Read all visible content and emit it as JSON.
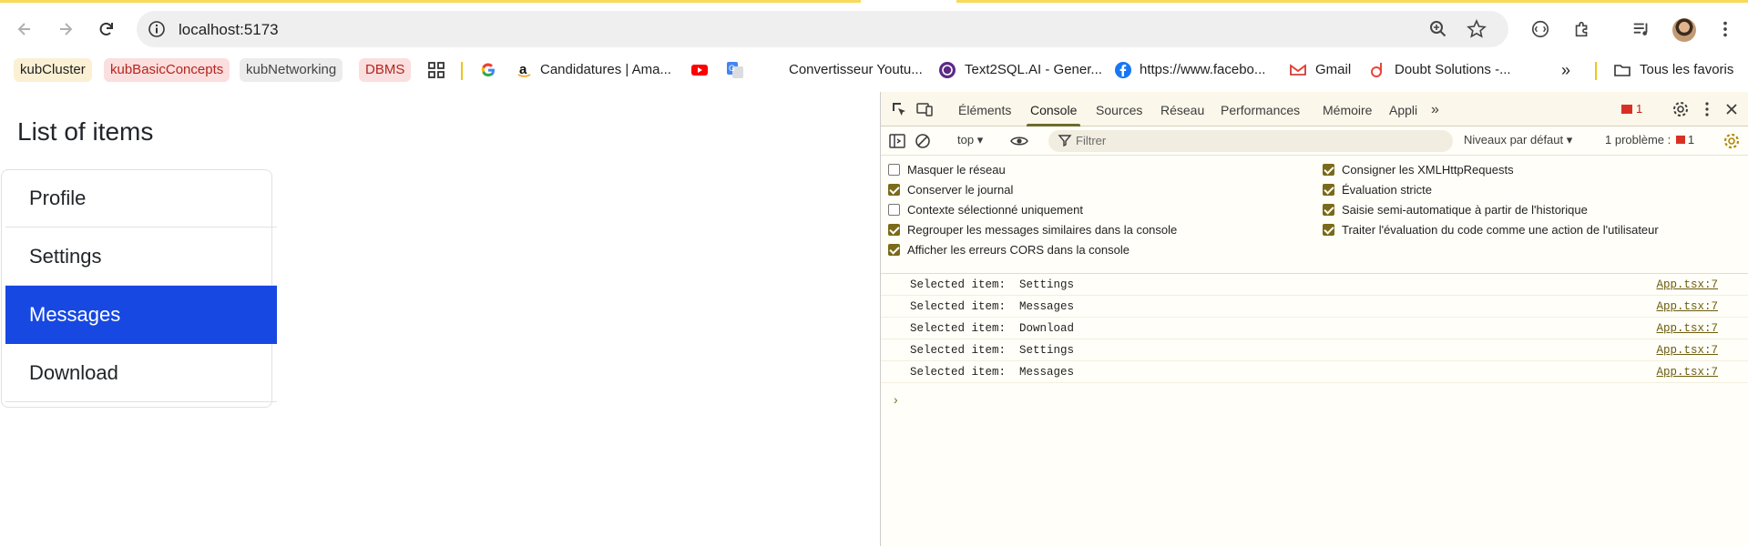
{
  "browser": {
    "url": "localhost:5173",
    "bookmarks": [
      {
        "label": "kubCluster"
      },
      {
        "label": "kubBasicConcepts"
      },
      {
        "label": "kubNetworking"
      },
      {
        "label": "DBMS"
      },
      {
        "label": "Candidatures | Ama..."
      },
      {
        "label": "Convertisseur Youtu..."
      },
      {
        "label": "Text2SQL.AI - Gener..."
      },
      {
        "label": "https://www.facebo..."
      },
      {
        "label": "Gmail"
      },
      {
        "label": "Doubt Solutions -..."
      },
      {
        "label": "Tous les favoris"
      }
    ],
    "more_bookmarks": "»"
  },
  "page": {
    "title": "List of items",
    "items": [
      {
        "label": "Profile",
        "active": false
      },
      {
        "label": "Settings",
        "active": false
      },
      {
        "label": "Messages",
        "active": true
      },
      {
        "label": "Download",
        "active": false
      }
    ]
  },
  "devtools": {
    "tabs": [
      "Éléments",
      "Console",
      "Sources",
      "Réseau",
      "Performances",
      "Mémoire",
      "Appli"
    ],
    "active_tab": "Console",
    "issue_count": "1",
    "context": "top",
    "filter_placeholder": "Filtrer",
    "levels": "Niveaux par défaut",
    "problems_label": "1 problème :",
    "problems_count": "1",
    "settings_left": [
      {
        "label": "Masquer le réseau",
        "checked": false
      },
      {
        "label": "Conserver le journal",
        "checked": true
      },
      {
        "label": "Contexte sélectionné uniquement",
        "checked": false
      },
      {
        "label": "Regrouper les messages similaires dans la console",
        "checked": true
      },
      {
        "label": "Afficher les erreurs CORS dans la console",
        "checked": true
      }
    ],
    "settings_right": [
      {
        "label": "Consigner les XMLHttpRequests",
        "checked": true
      },
      {
        "label": "Évaluation stricte",
        "checked": true
      },
      {
        "label": "Saisie semi-automatique à partir de l'historique",
        "checked": true
      },
      {
        "label": "Traiter l'évaluation du code comme une action de l'utilisateur",
        "checked": true
      }
    ],
    "logs": [
      {
        "message": "Selected item:  Settings",
        "source": "App.tsx:7"
      },
      {
        "message": "Selected item:  Messages",
        "source": "App.tsx:7"
      },
      {
        "message": "Selected item:  Download",
        "source": "App.tsx:7"
      },
      {
        "message": "Selected item:  Settings",
        "source": "App.tsx:7"
      },
      {
        "message": "Selected item:  Messages",
        "source": "App.tsx:7"
      }
    ],
    "prompt_symbol": "›"
  },
  "colors": {
    "active_item": "#1748e2",
    "accent_bar": "#f8d95a"
  }
}
